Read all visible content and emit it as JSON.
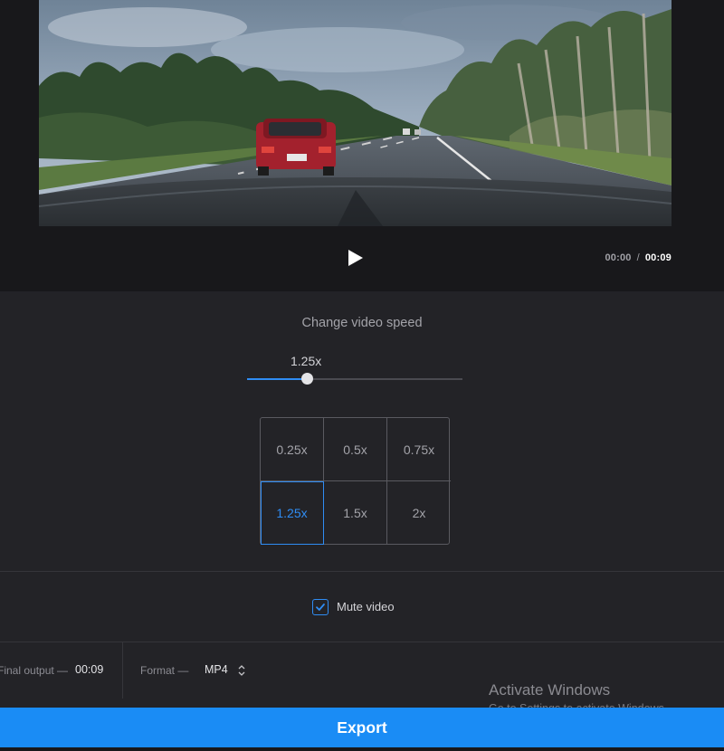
{
  "player": {
    "current_time": "00:00",
    "separator": "/",
    "total_time": "00:09",
    "play_icon": "play-icon"
  },
  "speed": {
    "title": "Change video speed",
    "current_value_label": "1.25x",
    "slider_fraction": 0.28,
    "accent_color": "#2f8cf3",
    "options": [
      "0.25x",
      "0.5x",
      "0.75x",
      "1.25x",
      "1.5x",
      "2x"
    ],
    "selected": "1.25x"
  },
  "mute": {
    "label": "Mute video",
    "checked": true,
    "icon": "checkmark-icon"
  },
  "output": {
    "final_output_label": "Final output —",
    "final_output_value": "00:09",
    "format_label": "Format —",
    "format_value": "MP4",
    "format_icon": "updown-chevron-icon"
  },
  "watermark": {
    "title": "Activate Windows",
    "subtitle": "Go to Settings to activate Windows."
  },
  "export": {
    "label": "Export",
    "color": "#1a8cf5"
  }
}
